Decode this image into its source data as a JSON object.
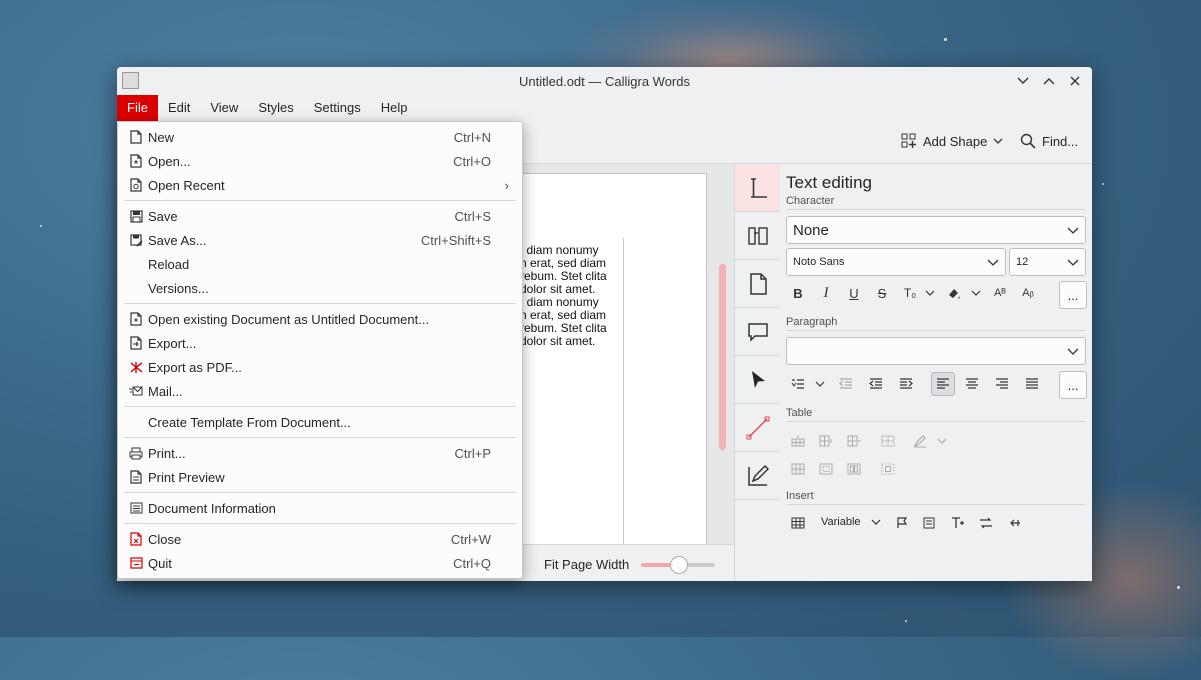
{
  "window": {
    "title": "Untitled.odt — Calligra Words",
    "controls": [
      "minimize",
      "maximize",
      "close"
    ]
  },
  "menubar": {
    "items": [
      {
        "label": "File",
        "active": true
      },
      {
        "label": "Edit"
      },
      {
        "label": "View"
      },
      {
        "label": "Styles"
      },
      {
        "label": "Settings"
      },
      {
        "label": "Help"
      }
    ]
  },
  "toolbar": {
    "add_shape": "Add Shape",
    "find": "Find..."
  },
  "file_menu": {
    "items": [
      {
        "label": "New",
        "shortcut": "Ctrl+N",
        "icon": "new-document-icon"
      },
      {
        "label": "Open...",
        "shortcut": "Ctrl+O",
        "icon": "open-document-icon"
      },
      {
        "label": "Open Recent",
        "shortcut": "",
        "icon": "open-recent-icon",
        "submenu": true
      },
      {
        "label": "Save",
        "shortcut": "Ctrl+S",
        "icon": "save-icon"
      },
      {
        "label": "Save As...",
        "shortcut": "Ctrl+Shift+S",
        "icon": "save-as-icon"
      },
      {
        "label": "Reload",
        "shortcut": ""
      },
      {
        "label": "Versions...",
        "shortcut": ""
      },
      {
        "label": "Open existing Document as Untitled Document...",
        "shortcut": "",
        "icon": "open-untitled-icon"
      },
      {
        "label": "Export...",
        "shortcut": "",
        "icon": "export-icon"
      },
      {
        "label": "Export as PDF...",
        "shortcut": "",
        "icon": "pdf-icon"
      },
      {
        "label": "Mail...",
        "shortcut": "",
        "icon": "mail-icon"
      },
      {
        "label": "Create Template From Document...",
        "shortcut": ""
      },
      {
        "label": "Print...",
        "shortcut": "Ctrl+P",
        "icon": "print-icon"
      },
      {
        "label": "Print Preview",
        "shortcut": "",
        "icon": "print-preview-icon"
      },
      {
        "label": "Document Information",
        "shortcut": "",
        "icon": "document-info-icon"
      },
      {
        "label": "Close",
        "shortcut": "Ctrl+W",
        "icon": "close-document-icon"
      },
      {
        "label": "Quit",
        "shortcut": "Ctrl+Q",
        "icon": "quit-icon"
      }
    ],
    "submenu_arrow": "›"
  },
  "document": {
    "lines": [
      "| diam nonumy",
      "n erat, sed diam",
      "rebum. Stet clita",
      "dolor sit amet.",
      ", diam nonumy",
      "n erat, sed diam",
      "rebum. Stet clita",
      "dolor sit amet."
    ]
  },
  "statusbar": {
    "zoom_label": "Fit Page Width",
    "zoom_slider_value": 0.5
  },
  "docker": {
    "title": "Text editing",
    "character": {
      "section": "Character",
      "style": "None",
      "font": "Noto Sans",
      "size": "12",
      "more": "..."
    },
    "paragraph": {
      "section": "Paragraph",
      "style": "",
      "more": "..."
    },
    "table": {
      "section": "Table"
    },
    "insert": {
      "section": "Insert",
      "variable": "Variable"
    }
  },
  "colors": {
    "accent": "#da0000",
    "menu_bg": "#fcfcfc",
    "window_bg": "#eff0f1",
    "scroll_accent": "#f0b2b5"
  }
}
